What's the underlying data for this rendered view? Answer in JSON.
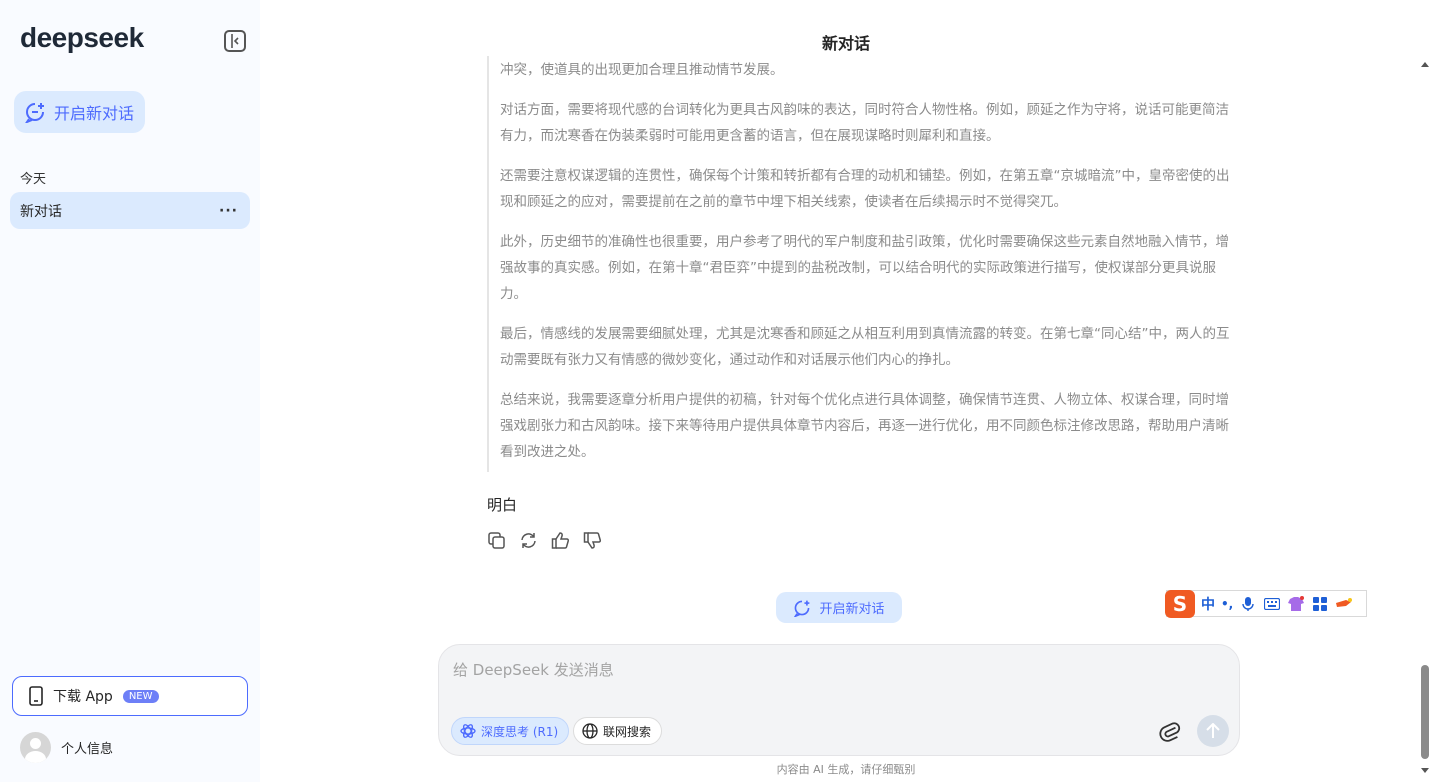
{
  "sidebar": {
    "logo": "deepseek",
    "new_chat_label": "开启新对话",
    "section_today": "今天",
    "conversations": [
      {
        "title": "新对话",
        "more": "···"
      }
    ],
    "download_app_label": "下载 App",
    "download_app_badge": "NEW",
    "profile_label": "个人信息"
  },
  "main": {
    "title": "新对话",
    "thinking": [
      "另外，用户希望重要道具如玉佩的出现更自然，比如在李珉中意外拜错，而不是刻意取出。这需要在场景设计中考虑动作和冲突，使道具的出现更加合理且推动情节发展。",
      "对话方面，需要将现代感的台词转化为更具古风韵味的表达，同时符合人物性格。例如，顾延之作为守将，说话可能更简洁有力，而沈寒香在伪装柔弱时可能用更含蓄的语言，但在展现谋略时则犀利和直接。",
      "还需要注意权谋逻辑的连贯性，确保每个计策和转折都有合理的动机和铺垫。例如，在第五章“京城暗流”中，皇帝密使的出现和顾延之的应对，需要提前在之前的章节中埋下相关线索，使读者在后续揭示时不觉得突兀。",
      "此外，历史细节的准确性也很重要，用户参考了明代的军户制度和盐引政策，优化时需要确保这些元素自然地融入情节，增强故事的真实感。例如，在第十章“君臣弈”中提到的盐税改制，可以结合明代的实际政策进行描写，使权谋部分更具说服力。",
      "最后，情感线的发展需要细腻处理，尤其是沈寒香和顾延之从相互利用到真情流露的转变。在第七章“同心结”中，两人的互动需要既有张力又有情感的微妙变化，通过动作和对话展示他们内心的挣扎。",
      "总结来说，我需要逐章分析用户提供的初稿，针对每个优化点进行具体调整，确保情节连贯、人物立体、权谋合理，同时增强戏剧张力和古风韵味。接下来等待用户提供具体章节内容后，再逐一进行优化，用不同颜色标注修改思路，帮助用户清晰看到改进之处。"
    ],
    "answer": "明白",
    "center_new_chat_label": "开启新对话",
    "input": {
      "placeholder": "给 DeepSeek 发送消息",
      "value": "",
      "deep_think_label": "深度思考 (R1)",
      "web_search_label": "联网搜索"
    },
    "disclaimer": "内容由 AI 生成，请仔细甄别"
  },
  "ime": {
    "logo": "S",
    "mode": "中",
    "punct": "•,",
    "icons": [
      "mic-icon",
      "keyboard-icon",
      "skin-icon",
      "apps-icon",
      "tools-icon"
    ]
  },
  "colors": {
    "accent": "#4d6bfe",
    "accent_bg": "#dbeafe",
    "sidebar_bg": "#f9fbff",
    "think_text": "#8b8b8b",
    "ime_brand": "#f05a22"
  }
}
